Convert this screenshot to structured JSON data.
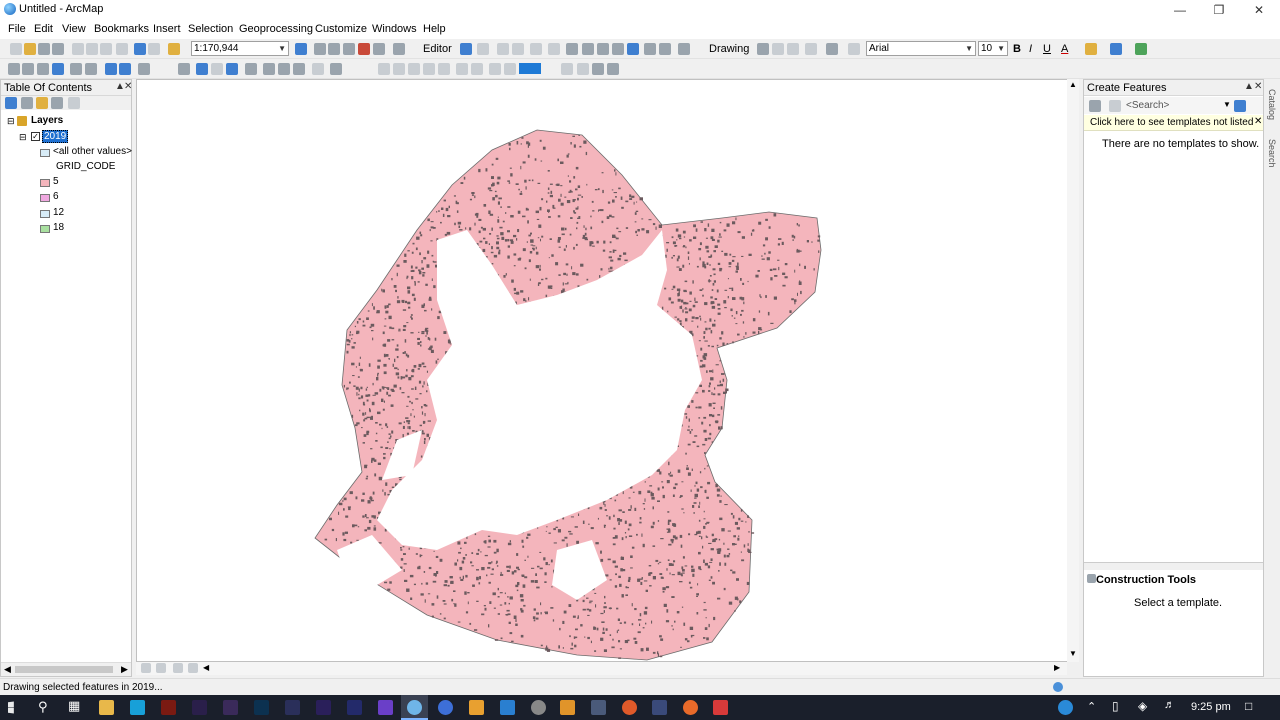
{
  "window": {
    "title": "Untitled - ArcMap"
  },
  "menu": [
    "File",
    "Edit",
    "View",
    "Bookmarks",
    "Insert",
    "Selection",
    "Geoprocessing",
    "Customize",
    "Windows",
    "Help"
  ],
  "toolbar": {
    "scale": "1:170,944",
    "editor_label": "Editor",
    "drawing_label": "Drawing",
    "font_name": "Arial",
    "font_size": "10",
    "bold": "B",
    "italic": "I",
    "underline": "U",
    "font_color_label": "A"
  },
  "toc": {
    "title": "Table Of Contents",
    "root": "Layers",
    "layer_name": "2019",
    "other_values": "<all other values>",
    "field": "GRID_CODE",
    "classes": [
      {
        "label": "5",
        "color": "#f4b5bc"
      },
      {
        "label": "6",
        "color": "#f0a8e0"
      },
      {
        "label": "12",
        "color": "#d8ecf7"
      },
      {
        "label": "18",
        "color": "#a9e0a0"
      }
    ],
    "other_color": "#d8ecf7"
  },
  "create_features": {
    "title": "Create Features",
    "search_placeholder": "<Search>",
    "hint": "Click here to see templates not listed",
    "no_templates": "There are no templates to show.",
    "construction_tools": "Construction Tools",
    "select_template": "Select a template."
  },
  "side_tabs": [
    "Catalog",
    "Search"
  ],
  "status": {
    "text": "Drawing selected features in 2019..."
  },
  "taskbar": {
    "time": "9:25 pm"
  },
  "map": {
    "fill_color": "#f4b5bc",
    "speck_color": "#6b5a5e",
    "background": "#ffffff"
  }
}
